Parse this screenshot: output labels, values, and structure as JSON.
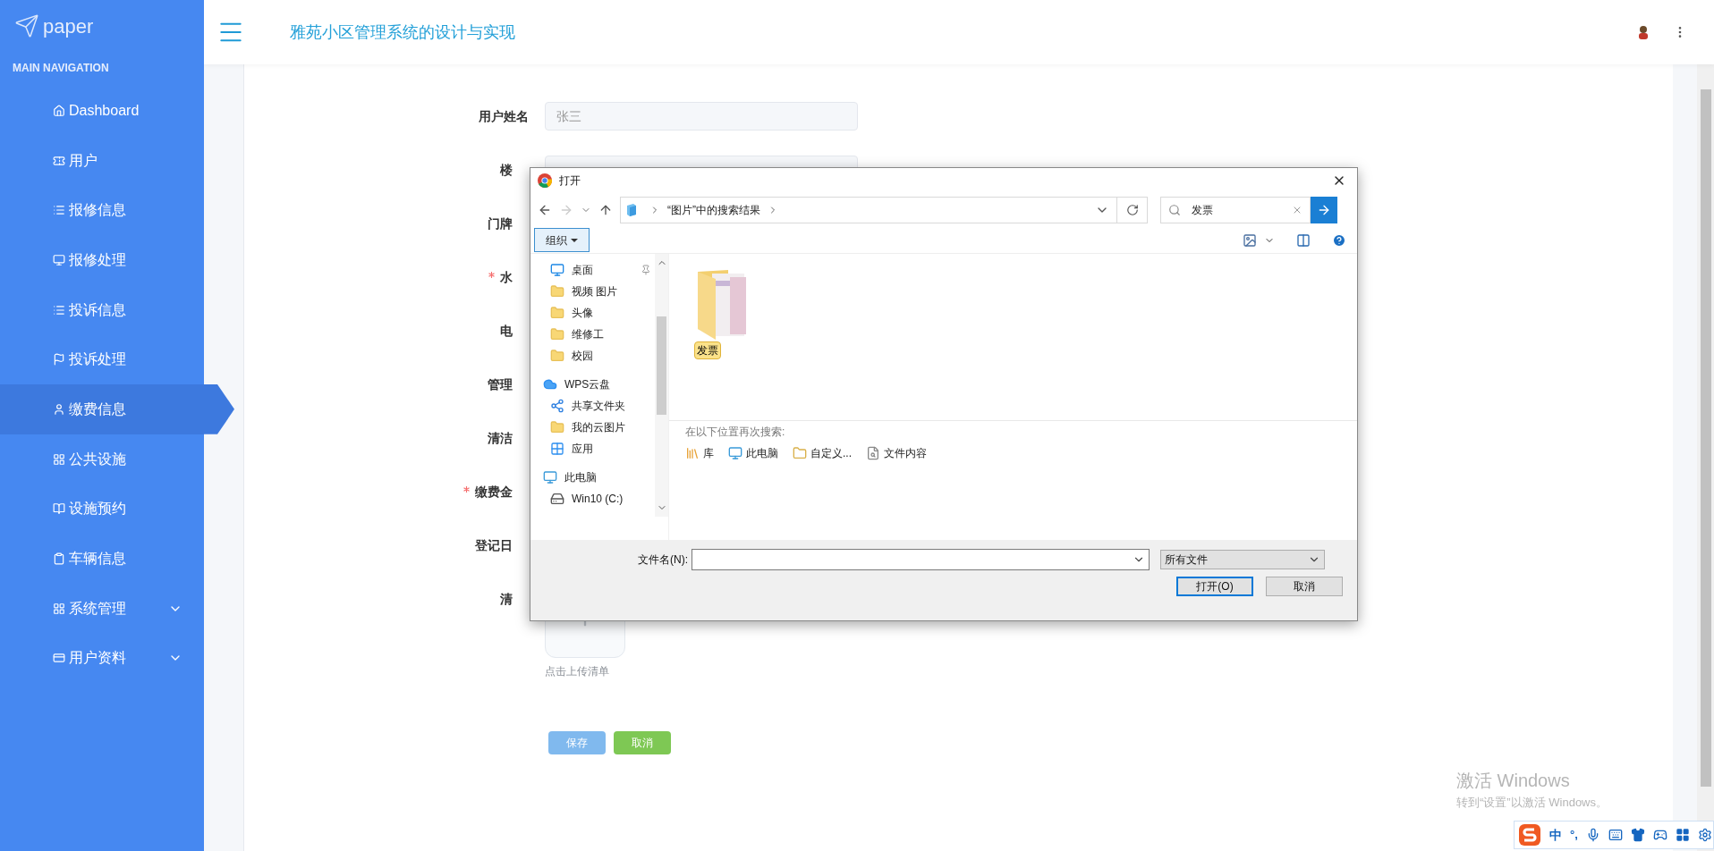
{
  "brand": "paper",
  "nav_heading": "MAIN NAVIGATION",
  "sidebar": {
    "items": [
      {
        "label": "Dashboard",
        "selected": false,
        "submenu": false
      },
      {
        "label": "用户",
        "selected": false,
        "submenu": false
      },
      {
        "label": "报修信息",
        "selected": false,
        "submenu": false
      },
      {
        "label": "报修处理",
        "selected": false,
        "submenu": false
      },
      {
        "label": "投诉信息",
        "selected": false,
        "submenu": false
      },
      {
        "label": "投诉处理",
        "selected": false,
        "submenu": false
      },
      {
        "label": "缴费信息",
        "selected": true,
        "submenu": false
      },
      {
        "label": "公共设施",
        "selected": false,
        "submenu": false
      },
      {
        "label": "设施预约",
        "selected": false,
        "submenu": false
      },
      {
        "label": "车辆信息",
        "selected": false,
        "submenu": false
      },
      {
        "label": "系统管理",
        "selected": false,
        "submenu": true
      },
      {
        "label": "用户资料",
        "selected": false,
        "submenu": true
      }
    ]
  },
  "header": {
    "title": "雅苑小区管理系统的设计与实现"
  },
  "form": {
    "fields": [
      {
        "label": "用户姓名",
        "kind": "input",
        "value": "张三",
        "required": false
      },
      {
        "label": "楼",
        "kind": "input",
        "required": false
      },
      {
        "label": "门牌",
        "kind": "label",
        "required": false
      },
      {
        "label": "水",
        "kind": "label",
        "required": true
      },
      {
        "label": "电",
        "kind": "label",
        "required": false
      },
      {
        "label": "管理",
        "kind": "label",
        "required": false
      },
      {
        "label": "清洁",
        "kind": "label",
        "required": false
      },
      {
        "label": "缴费金",
        "kind": "label",
        "required": true
      },
      {
        "label": "登记日",
        "kind": "label",
        "required": false
      },
      {
        "label": "清",
        "kind": "upload",
        "required": false
      }
    ],
    "upload_hint": "点击上传清单",
    "buttons": [
      {
        "label": "保存",
        "kind": "primary"
      },
      {
        "label": "取消",
        "kind": "success"
      }
    ]
  },
  "dialog": {
    "title": "打开",
    "address": "“图片”中的搜索结果",
    "search": {
      "value": "发票"
    },
    "organize": "组织",
    "nav": [
      {
        "label": "桌面",
        "kind": "desktop",
        "pinned": true
      },
      {
        "label": "视频 图片",
        "kind": "folder",
        "pinned": false
      },
      {
        "label": "头像",
        "kind": "folder",
        "pinned": false
      },
      {
        "label": "维修工",
        "kind": "folder",
        "pinned": false
      },
      {
        "label": "校园",
        "kind": "folder",
        "pinned": false
      },
      {
        "label": "WPS云盘",
        "kind": "cloud",
        "pinned": false,
        "children": [
          {
            "label": "共享文件夹",
            "kind": "share",
            "pinned": false
          },
          {
            "label": "我的云图片",
            "kind": "folder",
            "pinned": false
          },
          {
            "label": "应用",
            "kind": "apps",
            "pinned": false
          }
        ]
      },
      {
        "label": "此电脑",
        "kind": "pc",
        "pinned": false,
        "children": [
          {
            "label": "Win10 (C:)",
            "kind": "drive",
            "pinned": false
          }
        ]
      }
    ],
    "files": [
      {
        "name": "发票",
        "selected": true
      }
    ],
    "search_again": "在以下位置再次搜索:",
    "search_locations": [
      "库",
      "此电脑",
      "自定义...",
      "文件内容"
    ],
    "filename_label": "文件名(N):",
    "filetype": "所有文件",
    "buttons": [
      {
        "label": "打开(O)",
        "selected": true
      },
      {
        "label": "取消",
        "selected": false
      }
    ]
  },
  "windows_notice": {
    "title": "激活 Windows",
    "subtitle": "转到“设置”以激活 Windows。"
  },
  "ime": {
    "mode": "中",
    "punct": "°,"
  }
}
